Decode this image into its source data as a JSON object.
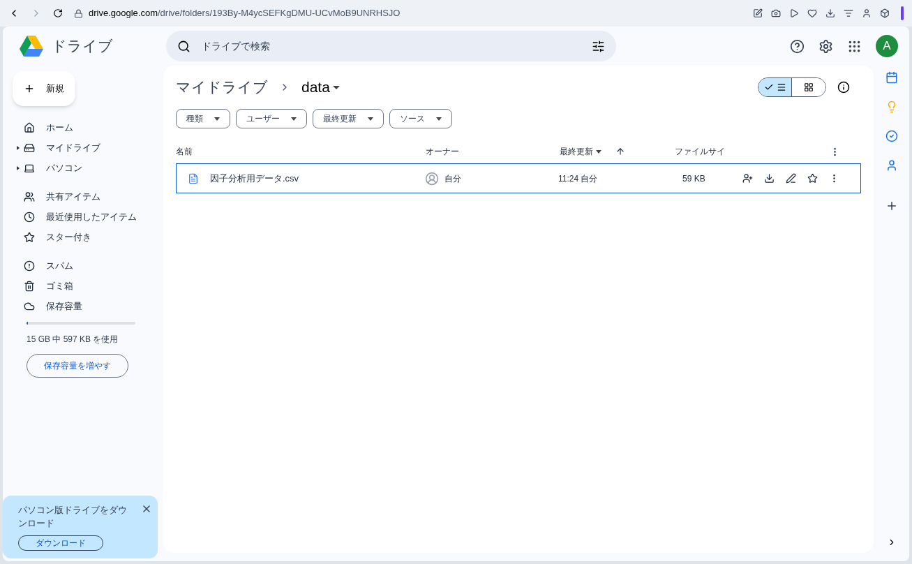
{
  "browser": {
    "url_host": "drive.google.com",
    "url_path": "/drive/folders/193By-M4ycSEFKgDMU-UCvMoB9UNRHSJO"
  },
  "app": {
    "title": "ドライブ",
    "search": {
      "placeholder": "ドライブで検索"
    },
    "avatar": "A"
  },
  "new_button": "新規",
  "sidebar": {
    "groups": [
      [
        {
          "label": "ホーム",
          "expandable": false,
          "selected": false
        },
        {
          "label": "マイドライブ",
          "expandable": true,
          "selected": false
        },
        {
          "label": "パソコン",
          "expandable": true,
          "selected": false
        }
      ],
      [
        {
          "label": "共有アイテム",
          "expandable": false,
          "selected": false
        },
        {
          "label": "最近使用したアイテム",
          "expandable": false,
          "selected": false
        },
        {
          "label": "スター付き",
          "expandable": false,
          "selected": false
        }
      ],
      [
        {
          "label": "スパム",
          "expandable": false,
          "selected": false
        },
        {
          "label": "ゴミ箱",
          "expandable": false,
          "selected": false
        },
        {
          "label": "保存容量",
          "expandable": false,
          "selected": false
        }
      ]
    ],
    "storage": {
      "level": 0.01,
      "text": "15 GB 中 597 KB を使用",
      "button": "保存容量を増やす"
    }
  },
  "promo": {
    "text": "パソコン版ドライブをダウンロード",
    "button": "ダウンロード"
  },
  "breadcrumb": [
    "マイドライブ",
    "data"
  ],
  "view_toggle": [
    {
      "selected": true
    },
    {
      "selected": false
    }
  ],
  "filters": [
    "種類",
    "ユーザー",
    "最終更新",
    "ソース"
  ],
  "table": {
    "columns": [
      "名前",
      "オーナー",
      "最終更新",
      "ファイルサイ"
    ],
    "rows": [
      {
        "name": "因子分析用データ.csv",
        "owner": "自分",
        "modified": "11:24 自分",
        "size": "59 KB",
        "selected": true
      }
    ]
  }
}
